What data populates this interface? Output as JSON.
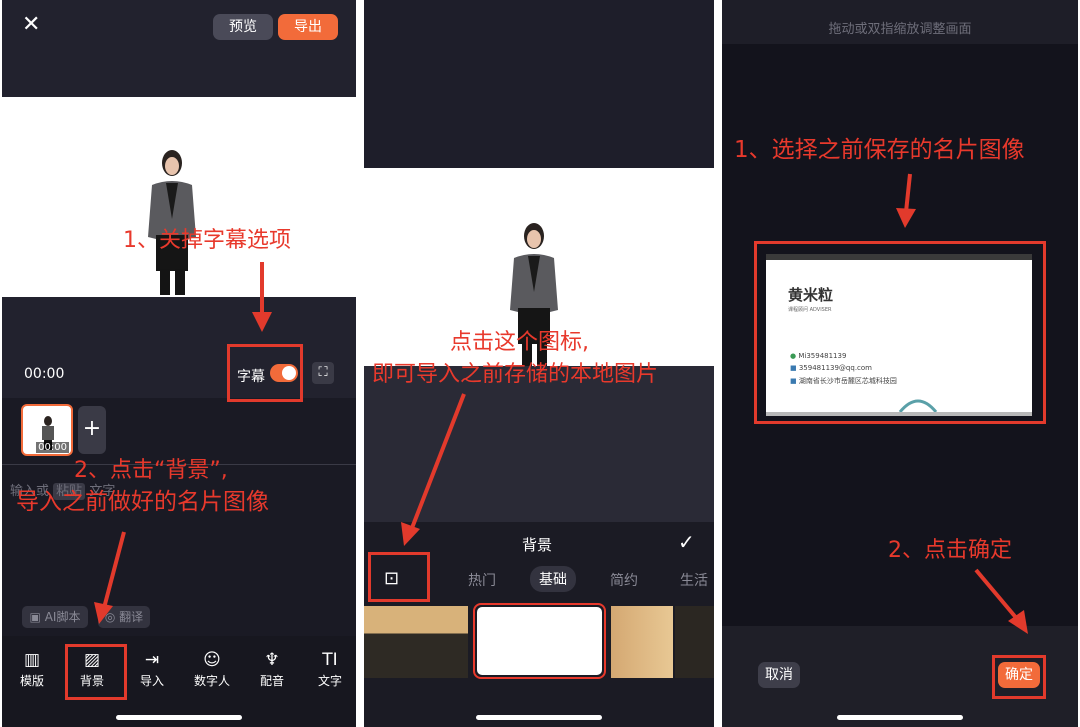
{
  "panel1": {
    "close_icon": "close-icon",
    "preview_button": "预览",
    "export_button": "导出",
    "timecode": "00:00",
    "subtitle_label": "字幕",
    "fullscreen_icon": "fullscreen-icon",
    "clip_time": "00:00",
    "add_icon": "+",
    "input_ghost_1": "输入或",
    "input_ghost_2": "粘贴",
    "input_ghost_3": "文字",
    "ai_script_label": "AI脚本",
    "translate_label": "翻译",
    "toolbar": [
      {
        "label": "模版",
        "icon": "template-icon"
      },
      {
        "label": "背景",
        "icon": "background-icon"
      },
      {
        "label": "导入",
        "icon": "import-icon"
      },
      {
        "label": "数字人",
        "icon": "digital-human-icon"
      },
      {
        "label": "配音",
        "icon": "microphone-icon"
      },
      {
        "label": "文字",
        "icon": "text-icon"
      }
    ],
    "annotation_1": "1、关掉字幕选项",
    "annotation_2_line1": "2、点击“背景”,",
    "annotation_2_line2": "导入之前做好的名片图像"
  },
  "panel2": {
    "annotation_line1": "点击这个图标,",
    "annotation_line2": "即可导入之前存储的本地图片",
    "sheet_title": "背景",
    "confirm_icon": "check-icon",
    "import_image_icon": "image-add-icon",
    "tabs": [
      "热门",
      "基础",
      "简约",
      "生活"
    ],
    "active_tab": "基础"
  },
  "panel3": {
    "hint": "拖动或双指缩放调整画面",
    "annotation_1": "1、选择之前保存的名片图像",
    "annotation_2": "2、点击确定",
    "card": {
      "name": "黄米粒",
      "title_cn": "课程顾问",
      "title_en": "ADVISER",
      "wechat": "Mi359481139",
      "email": "359481139@qq.com",
      "address": "湖南省长沙市岳麓区芯城科技园"
    },
    "cancel_button": "取消",
    "confirm_button": "确定"
  },
  "colors": {
    "accent": "#f26b3a",
    "annotation_red": "#e23a2c",
    "dark_bg": "#22222e"
  }
}
